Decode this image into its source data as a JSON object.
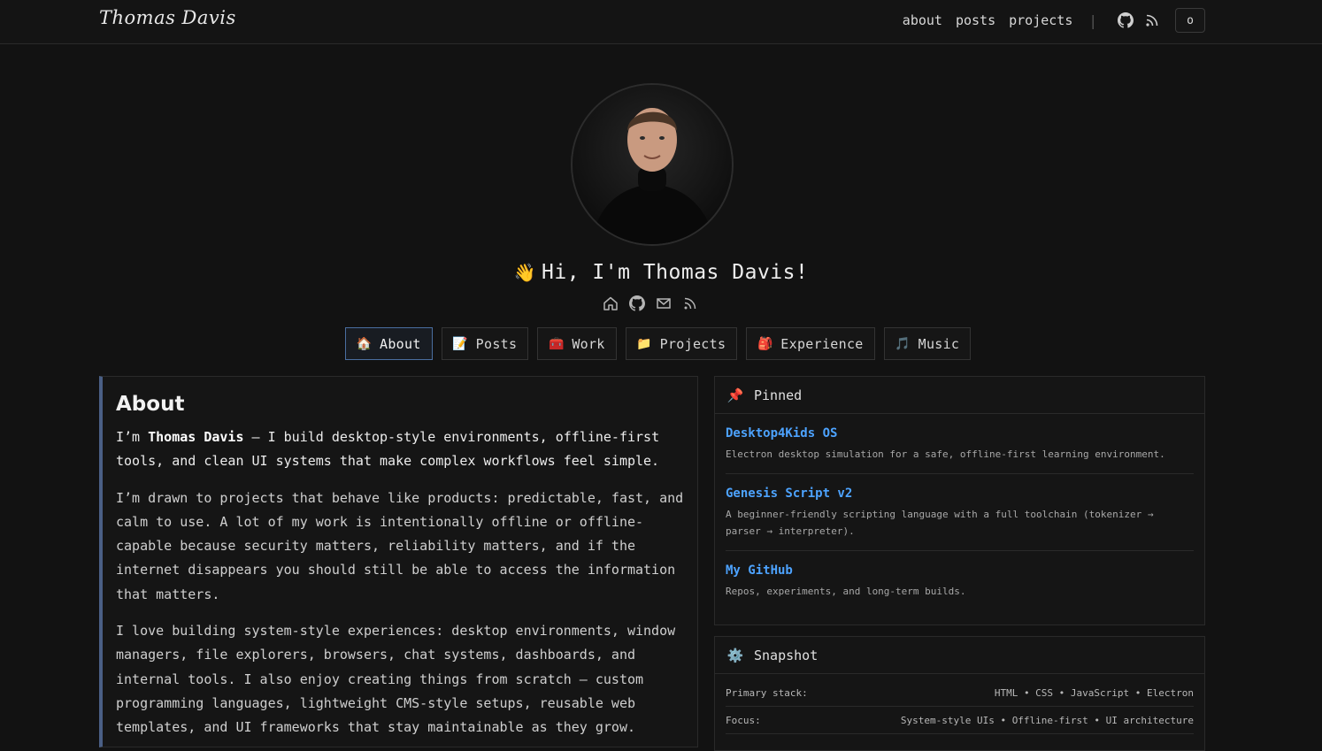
{
  "header": {
    "brand": "Thomas Davis",
    "nav": [
      "about",
      "posts",
      "projects"
    ],
    "separator": "|",
    "theme_toggle": "o"
  },
  "hero": {
    "wave": "👋",
    "greeting": "Hi, I'm Thomas Davis!"
  },
  "tabs": [
    {
      "icon": "🏠",
      "label": "About"
    },
    {
      "icon": "📝",
      "label": "Posts"
    },
    {
      "icon": "🧰",
      "label": "Work"
    },
    {
      "icon": "📁",
      "label": "Projects"
    },
    {
      "icon": "🎒",
      "label": "Experience"
    },
    {
      "icon": "🎵",
      "label": "Music"
    }
  ],
  "about": {
    "heading": "About",
    "lead_pre": "I’m ",
    "lead_name": "Thomas Davis",
    "lead_post": " — I build desktop-style environments, offline-first tools, and clean UI systems that make complex workflows feel simple.",
    "p2": "I’m drawn to projects that behave like products: predictable, fast, and calm to use. A lot of my work is intentionally offline or offline-capable because security matters, reliability matters, and if the internet disappears you should still be able to access the information that matters.",
    "p3": "I love building system-style experiences: desktop environments, window managers, file explorers, browsers, chat systems, dashboards, and internal tools. I also enjoy creating things from scratch — custom programming languages, lightweight CMS-style setups, reusable web templates, and UI frameworks that stay maintainable as they grow."
  },
  "pinned": {
    "icon": "📌",
    "title": "Pinned",
    "items": [
      {
        "title": "Desktop4Kids OS",
        "desc": "Electron desktop simulation for a safe, offline-first learning environment."
      },
      {
        "title": "Genesis Script v2",
        "desc": "A beginner-friendly scripting language with a full toolchain (tokenizer → parser → interpreter)."
      },
      {
        "title": "My GitHub",
        "desc": "Repos, experiments, and long-term builds."
      }
    ]
  },
  "snapshot": {
    "icon": "⚙️",
    "title": "Snapshot",
    "rows": [
      {
        "label": "Primary stack:",
        "value": "HTML • CSS • JavaScript • Electron"
      },
      {
        "label": "Focus:",
        "value": "System-style UIs • Offline-first • UI architecture"
      }
    ]
  }
}
